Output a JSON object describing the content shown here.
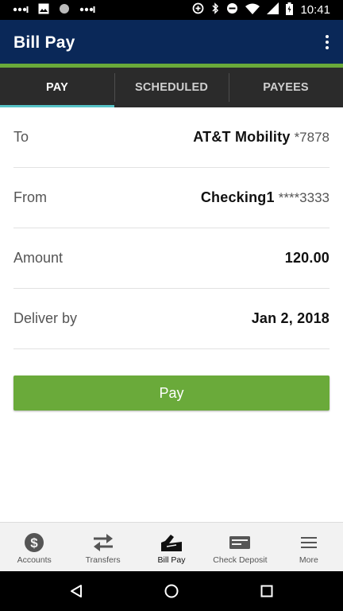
{
  "status_bar": {
    "time": "10:41",
    "left_icons": [
      "signal-dots-icon",
      "image-icon",
      "record-icon",
      "signal-dots-icon"
    ],
    "right_icons": [
      "data-saver-icon",
      "bluetooth-icon",
      "do-not-disturb-icon",
      "wifi-icon",
      "cell-signal-icon",
      "battery-icon"
    ]
  },
  "app_bar": {
    "title": "Bill Pay",
    "background_color": "#0a2858",
    "accent_color": "#6aaa3a"
  },
  "tabs": [
    {
      "label": "PAY",
      "active": true
    },
    {
      "label": "SCHEDULED",
      "active": false
    },
    {
      "label": "PAYEES",
      "active": false
    }
  ],
  "form": {
    "to": {
      "label": "To",
      "value": "AT&T Mobility",
      "suffix": "*7878"
    },
    "from": {
      "label": "From",
      "value": "Checking1",
      "suffix": "****3333"
    },
    "amount": {
      "label": "Amount",
      "value": "120.00"
    },
    "deliver_by": {
      "label": "Deliver by",
      "value": "Jan 2, 2018"
    }
  },
  "pay_button": {
    "label": "Pay",
    "color": "#6aaa3a"
  },
  "bottom_nav": [
    {
      "label": "Accounts",
      "icon": "dollar-circle-icon",
      "active": false
    },
    {
      "label": "Transfers",
      "icon": "transfer-arrows-icon",
      "active": false
    },
    {
      "label": "Bill Pay",
      "icon": "bill-pay-icon",
      "active": true
    },
    {
      "label": "Check Deposit",
      "icon": "check-icon",
      "active": false
    },
    {
      "label": "More",
      "icon": "hamburger-menu-icon",
      "active": false
    }
  ],
  "system_nav": [
    "back-icon",
    "home-icon",
    "recents-icon"
  ]
}
